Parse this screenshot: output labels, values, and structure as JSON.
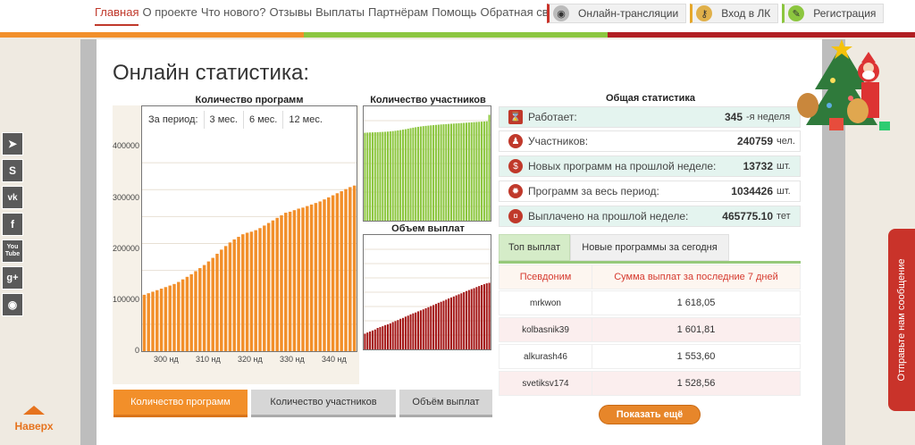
{
  "nav": {
    "items": [
      "Главная",
      "О проекте",
      "Что нового?",
      "Отзывы",
      "Выплаты",
      "Партнёрам",
      "Помощь",
      "Обратная связь"
    ],
    "active": "Главная"
  },
  "topbuttons": {
    "online": "Онлайн-трансляции",
    "login": "Вход в ЛК",
    "register": "Регистрация"
  },
  "colors": {
    "accent_orange": "#f28f2a",
    "green": "#8cc63f",
    "red": "#a31515",
    "stripe_red": "#b11e22"
  },
  "social": [
    "telegram-icon",
    "skype-icon",
    "vk-icon",
    "facebook-icon",
    "youtube-icon",
    "google-plus-icon",
    "rss-icon"
  ],
  "social_text": [
    "➤",
    "S",
    "vk",
    "f",
    "You Tube",
    "g+",
    "◉"
  ],
  "totop": "Наверх",
  "page_title": "Онлайн статистика:",
  "chart_main": {
    "title": "Количество программ",
    "period_label": "За период:",
    "periods": [
      "3 мес.",
      "6 мес.",
      "12 мес."
    ],
    "yticks": [
      "400000",
      "300000",
      "200000",
      "100000",
      "0"
    ],
    "xticks": [
      "300 нд",
      "310 нд",
      "320 нд",
      "330 нд",
      "340 нд"
    ]
  },
  "chart_participants": {
    "title": "Количество участников"
  },
  "chart_payouts": {
    "title": "Объем выплат"
  },
  "chart_data": [
    {
      "type": "bar",
      "title": "Количество программ",
      "x": [
        296,
        297,
        298,
        299,
        300,
        301,
        302,
        303,
        304,
        305,
        306,
        307,
        308,
        309,
        310,
        311,
        312,
        313,
        314,
        315,
        316,
        317,
        318,
        319,
        320,
        321,
        322,
        323,
        324,
        325,
        326,
        327,
        328,
        329,
        330,
        331,
        332,
        333,
        334,
        335,
        336,
        337,
        338,
        339,
        340,
        341,
        342,
        343,
        344,
        345
      ],
      "values": [
        110000,
        113000,
        116000,
        119000,
        122000,
        125000,
        128000,
        131000,
        135000,
        140000,
        145000,
        150000,
        156000,
        162000,
        168000,
        175000,
        182000,
        190000,
        198000,
        205000,
        212000,
        218000,
        223000,
        228000,
        231000,
        233000,
        236000,
        240000,
        245000,
        250000,
        255000,
        260000,
        265000,
        270000,
        272000,
        275000,
        278000,
        280000,
        283000,
        286000,
        289000,
        292000,
        296000,
        300000,
        304000,
        308000,
        312000,
        316000,
        320000,
        323000
      ],
      "ylim": [
        0,
        420000
      ],
      "color": "#f28f2a"
    },
    {
      "type": "bar",
      "title": "Количество участников",
      "values": [
        200000,
        200300,
        200600,
        200800,
        201000,
        201300,
        201600,
        201900,
        202200,
        202600,
        203100,
        203700,
        204400,
        205200,
        206000,
        207000,
        208000,
        209200,
        210400,
        211500,
        212500,
        213400,
        214200,
        215000,
        215600,
        216200,
        216800,
        217300,
        217800,
        218300,
        218800,
        219200,
        219600,
        220000,
        220400,
        220800,
        221200,
        221600,
        222000,
        222400,
        222800,
        223200,
        223600,
        224000,
        224400,
        224800,
        225200,
        225600,
        226000,
        240759
      ],
      "ylim": [
        0,
        260000
      ],
      "color": "#8cc63f"
    },
    {
      "type": "bar",
      "title": "Объем выплат",
      "values": [
        110000,
        118000,
        125000,
        132000,
        139000,
        150000,
        156000,
        162000,
        170000,
        175000,
        182000,
        191000,
        198000,
        205000,
        214000,
        220000,
        229000,
        236000,
        245000,
        252000,
        258000,
        266000,
        273000,
        280000,
        288000,
        295000,
        303000,
        310000,
        318000,
        326000,
        333000,
        340000,
        348000,
        356000,
        363000,
        370000,
        378000,
        385000,
        392000,
        400000,
        408000,
        415000,
        422000,
        428000,
        436000,
        443000,
        450000,
        456000,
        462000,
        465775
      ],
      "ylim": [
        0,
        800000
      ],
      "color": "#a31515"
    }
  ],
  "chart_tabs": [
    "Количество программ",
    "Количество участников",
    "Объём выплат"
  ],
  "stats": {
    "title": "Общая статистика",
    "rows": [
      {
        "icon": "hourglass-icon",
        "label": "Работает:",
        "value": "345",
        "unit": "-я неделя"
      },
      {
        "icon": "people-icon",
        "label": "Участников:",
        "value": "240759",
        "unit": "чел."
      },
      {
        "icon": "money-bag-icon",
        "label": "Новых программ на прошлой неделе:",
        "value": "13732",
        "unit": "шт."
      },
      {
        "icon": "bulb-icon",
        "label": "Программ за весь период:",
        "value": "1034426",
        "unit": "шт."
      },
      {
        "icon": "payout-icon",
        "label": "Выплачено на прошлой неделе:",
        "value": "465775.10",
        "unit": "тет"
      }
    ]
  },
  "top_tabs": [
    "Топ выплат",
    "Новые программы за сегодня"
  ],
  "top_table": {
    "headers": [
      "Псевдоним",
      "Сумма выплат за последние 7 дней"
    ],
    "rows": [
      {
        "name": "mrkwon",
        "amount": "1 618,05"
      },
      {
        "name": "kolbasnik39",
        "amount": "1 601,81"
      },
      {
        "name": "alkurash46",
        "amount": "1 553,60"
      },
      {
        "name": "svetiksv174",
        "amount": "1 528,56"
      }
    ]
  },
  "show_more": "Показать ещё",
  "feedback": "Отправьте нам сообщение"
}
